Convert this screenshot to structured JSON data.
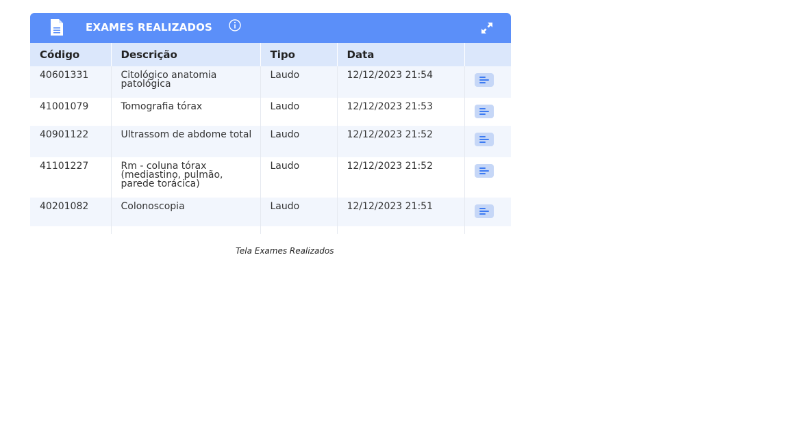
{
  "panel": {
    "title": "EXAMES REALIZADOS",
    "header_color": "#5b8ff9",
    "icons": {
      "document": "document-icon",
      "info": "info-icon",
      "expand": "expand-icon"
    }
  },
  "table": {
    "columns": [
      "Código",
      "Descrição",
      "Tipo",
      "Data"
    ],
    "rows": [
      {
        "codigo": "40601331",
        "descricao": "Citológico anatomia patológica",
        "tipo": "Laudo",
        "data": "12/12/2023 21:54"
      },
      {
        "codigo": "41001079",
        "descricao": "Tomografia tórax",
        "tipo": "Laudo",
        "data": "12/12/2023 21:53"
      },
      {
        "codigo": "40901122",
        "descricao": "Ultrassom de abdome total",
        "tipo": "Laudo",
        "data": "12/12/2023 21:52"
      },
      {
        "codigo": "41101227",
        "descricao": "Rm - coluna tórax (mediastino, pulmão, parede torácica)",
        "tipo": "Laudo",
        "data": "12/12/2023 21:52"
      },
      {
        "codigo": "40201082",
        "descricao": "Colonoscopia",
        "tipo": "Laudo",
        "data": "12/12/2023 21:51"
      }
    ]
  },
  "caption": "Tela Exames Realizados"
}
